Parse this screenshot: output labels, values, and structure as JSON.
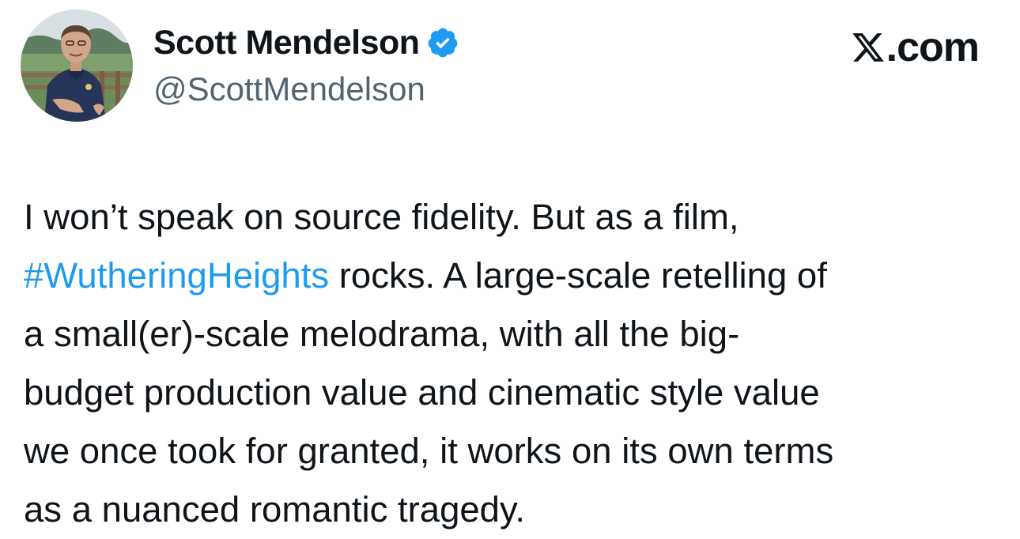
{
  "author": {
    "display_name": "Scott Mendelson",
    "handle": "@ScottMendelson",
    "verified": true,
    "avatar_icon": "user-photo-avatar"
  },
  "site": {
    "logo_icon": "x-logo-icon",
    "label": ".com"
  },
  "tweet": {
    "lines": [
      {
        "segments": [
          {
            "text": "I won’t speak on source fidelity. But as a film,",
            "kind": "text"
          }
        ]
      },
      {
        "segments": [
          {
            "text": "#WutheringHeights",
            "kind": "hashtag"
          },
          {
            "text": " rocks. A large-scale retelling of",
            "kind": "text"
          }
        ]
      },
      {
        "segments": [
          {
            "text": "a small(er)-scale melodrama, with all the big-",
            "kind": "text"
          }
        ]
      },
      {
        "segments": [
          {
            "text": "budget production value and cinematic style value",
            "kind": "text"
          }
        ]
      },
      {
        "segments": [
          {
            "text": "we once took for granted, it works on its own terms",
            "kind": "text"
          }
        ]
      },
      {
        "segments": [
          {
            "text": "as a nuanced romantic tragedy.",
            "kind": "text"
          }
        ]
      }
    ]
  },
  "colors": {
    "text": "#0f1419",
    "handle": "#536471",
    "hashtag": "#1d9bf0",
    "verified_badge": "#1d9bf0"
  }
}
